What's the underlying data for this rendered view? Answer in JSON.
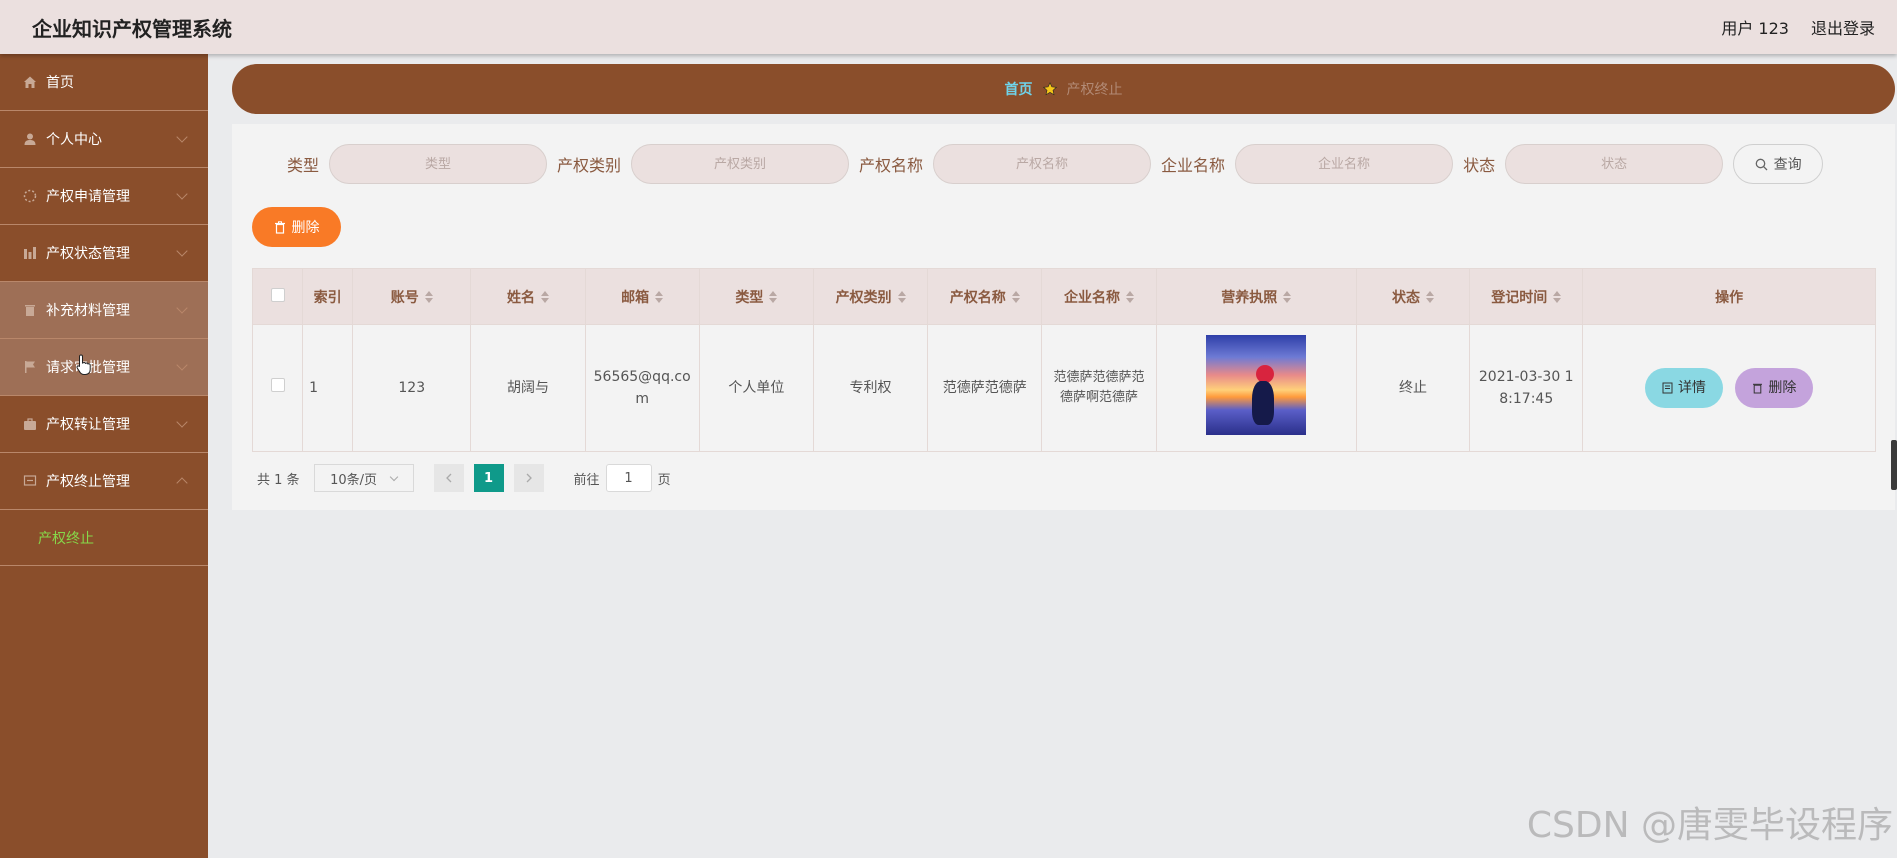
{
  "header": {
    "app_title": "企业知识产权管理系统",
    "user_label": "用户 123",
    "logout_label": "退出登录"
  },
  "sidebar": {
    "items": [
      {
        "label": "首页",
        "icon": "home-icon"
      },
      {
        "label": "个人中心",
        "icon": "user-icon"
      },
      {
        "label": "产权申请管理",
        "icon": "loading-icon"
      },
      {
        "label": "产权状态管理",
        "icon": "bar-chart-icon"
      },
      {
        "label": "补充材料管理",
        "icon": "trash-icon"
      },
      {
        "label": "请求审批管理",
        "icon": "flag-icon"
      },
      {
        "label": "产权转让管理",
        "icon": "briefcase-icon"
      },
      {
        "label": "产权终止管理",
        "icon": "message-icon"
      }
    ],
    "submenu": {
      "label": "产权终止"
    }
  },
  "breadcrumb": {
    "home": "首页",
    "current": "产权终止"
  },
  "search": {
    "type": {
      "label": "类型",
      "placeholder": "类型"
    },
    "category": {
      "label": "产权类别",
      "placeholder": "产权类别"
    },
    "ip_name": {
      "label": "产权名称",
      "placeholder": "产权名称"
    },
    "company": {
      "label": "企业名称",
      "placeholder": "企业名称"
    },
    "status": {
      "label": "状态",
      "placeholder": "状态"
    },
    "query_label": "查询"
  },
  "toolbar": {
    "delete_label": "删除"
  },
  "table": {
    "columns": [
      "索引",
      "账号",
      "姓名",
      "邮箱",
      "类型",
      "产权类别",
      "产权名称",
      "企业名称",
      "营养执照",
      "状态",
      "登记时间",
      "操作"
    ],
    "rows": [
      {
        "index": "1",
        "account": "123",
        "name": "胡阔与",
        "email": "56565@qq.com",
        "type": "个人单位",
        "category": "专利权",
        "ip_name": "范德萨范德萨",
        "company": "范德萨范德萨范德萨啊范德萨",
        "status": "终止",
        "time": "2021-03-30 18:17:45",
        "detail_label": "详情",
        "delete_label": "删除"
      }
    ]
  },
  "pagination": {
    "total": "共 1 条",
    "page_size": "10条/页",
    "current": "1",
    "goto_prefix": "前往",
    "goto_value": "1",
    "goto_suffix": "页"
  },
  "watermark": "CSDN @唐雯毕设程序",
  "colors": {
    "sidebar": "#8a4e2b",
    "header": "#ebe0df",
    "accent_orange": "#f97a26",
    "detail_button": "#8ad8e3",
    "delete_button": "#c4a3dc",
    "pager_active": "#0f9a8a",
    "submenu_active": "#86d84a"
  }
}
